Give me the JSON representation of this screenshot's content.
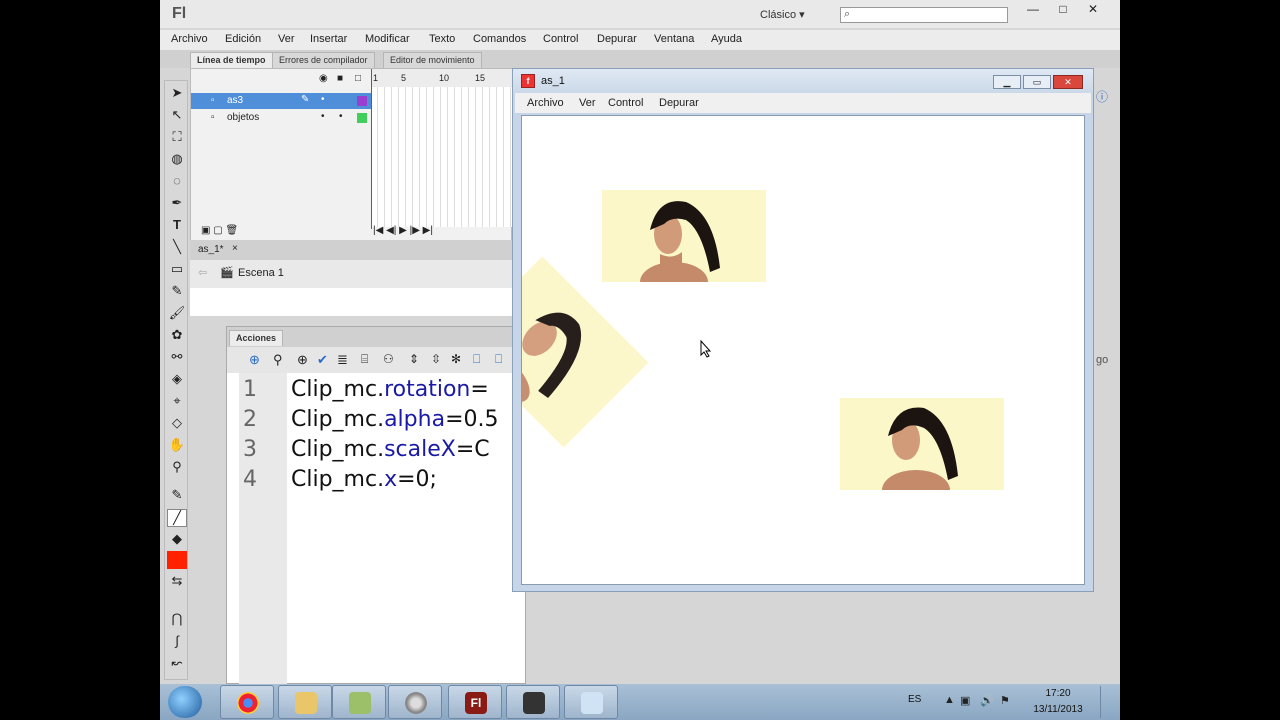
{
  "app": {
    "logo": "Fl",
    "workspace": "Clásico",
    "search_icon": "search-icon",
    "menu": [
      "Archivo",
      "Edición",
      "Ver",
      "Insertar",
      "Modificar",
      "Texto",
      "Comandos",
      "Control",
      "Depurar",
      "Ventana",
      "Ayuda"
    ]
  },
  "panels": {
    "tabs": [
      "Línea de tiempo",
      "Errores de compilador",
      "Editor de movimiento"
    ],
    "timeline_numbers": [
      "1",
      "5",
      "10",
      "15"
    ],
    "layers": [
      "as3",
      "objetos"
    ],
    "doc_tab": "as_1*",
    "doc_tab_close": "×",
    "scene": "Escena 1",
    "actions_tab": "Acciones",
    "right_fragment": "go"
  },
  "code": {
    "lines": [
      {
        "num": "1",
        "obj": "Clip_mc.",
        "prop": "rotation",
        "rest": "="
      },
      {
        "num": "2",
        "obj": "Clip_mc.",
        "prop": "alpha",
        "rest": "=0.5"
      },
      {
        "num": "3",
        "obj": "Clip_mc.",
        "prop": "scaleX",
        "rest": "=C"
      },
      {
        "num": "4",
        "obj": "Clip_mc.",
        "prop": "x",
        "rest": "=0;"
      }
    ]
  },
  "swf": {
    "title": "as_1",
    "menu": [
      "Archivo",
      "Ver",
      "Control",
      "Depurar"
    ]
  },
  "taskbar": {
    "lang": "ES",
    "time": "17:20",
    "date": "13/11/2013",
    "apps": [
      "chrome-icon",
      "explorer-icon",
      "app-icon",
      "media-icon",
      "flash-icon",
      "camera-icon",
      "notes-icon"
    ]
  },
  "colors": {
    "selected_layer": "#4f8ed8",
    "keyword": "#1a1aa6",
    "clip_bg": "#fbf7c8",
    "fill_swatch": "#ff2200"
  }
}
